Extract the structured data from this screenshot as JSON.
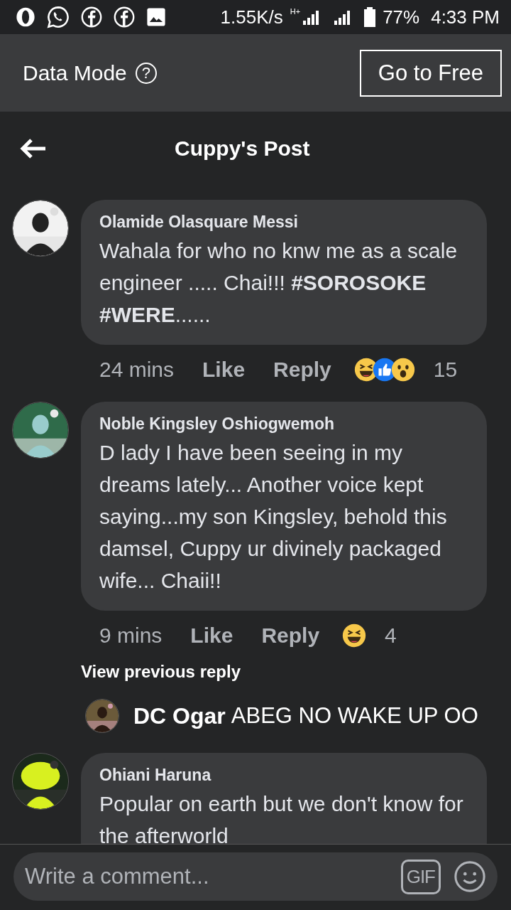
{
  "status_bar": {
    "speed": "1.55K/s",
    "network": "H+",
    "battery": "77%",
    "time": "4:33 PM"
  },
  "data_mode": {
    "label": "Data Mode",
    "help": "?",
    "button": "Go to Free"
  },
  "header": {
    "title": "Cuppy's Post"
  },
  "comments": [
    {
      "kind": "comment",
      "author": "Olamide Olasquare Messi",
      "text": "Wahala for who no knw me as a scale engineer ..... Chai!!! **#SOROSOKE #WERE**......",
      "time": "24 mins",
      "like": "Like",
      "reply": "Reply",
      "reactions": [
        {
          "kind": "haha"
        },
        {
          "kind": "like"
        },
        {
          "kind": "wow"
        }
      ],
      "reaction_count": "15"
    },
    {
      "kind": "comment",
      "author": "Noble Kingsley Oshiogwemoh",
      "text": "D lady I have been seeing in my dreams lately... Another voice kept saying...my son Kingsley, behold this damsel, Cuppy ur divinely packaged wife... Chaii!!",
      "time": "9 mins",
      "like": "Like",
      "reply": "Reply",
      "reactions": [
        {
          "kind": "haha"
        }
      ],
      "reaction_count": "4"
    },
    {
      "kind": "more_replies",
      "text": "View previous reply"
    },
    {
      "kind": "reply",
      "author": "DC Ogar",
      "text": "ABEG NO WAKE UP OO"
    },
    {
      "kind": "comment",
      "author": "Ohiani Haruna",
      "text": "Popular on earth but we don't know for the afterworld"
    }
  ],
  "composer": {
    "placeholder": "Write a comment...",
    "gif": "GIF"
  }
}
